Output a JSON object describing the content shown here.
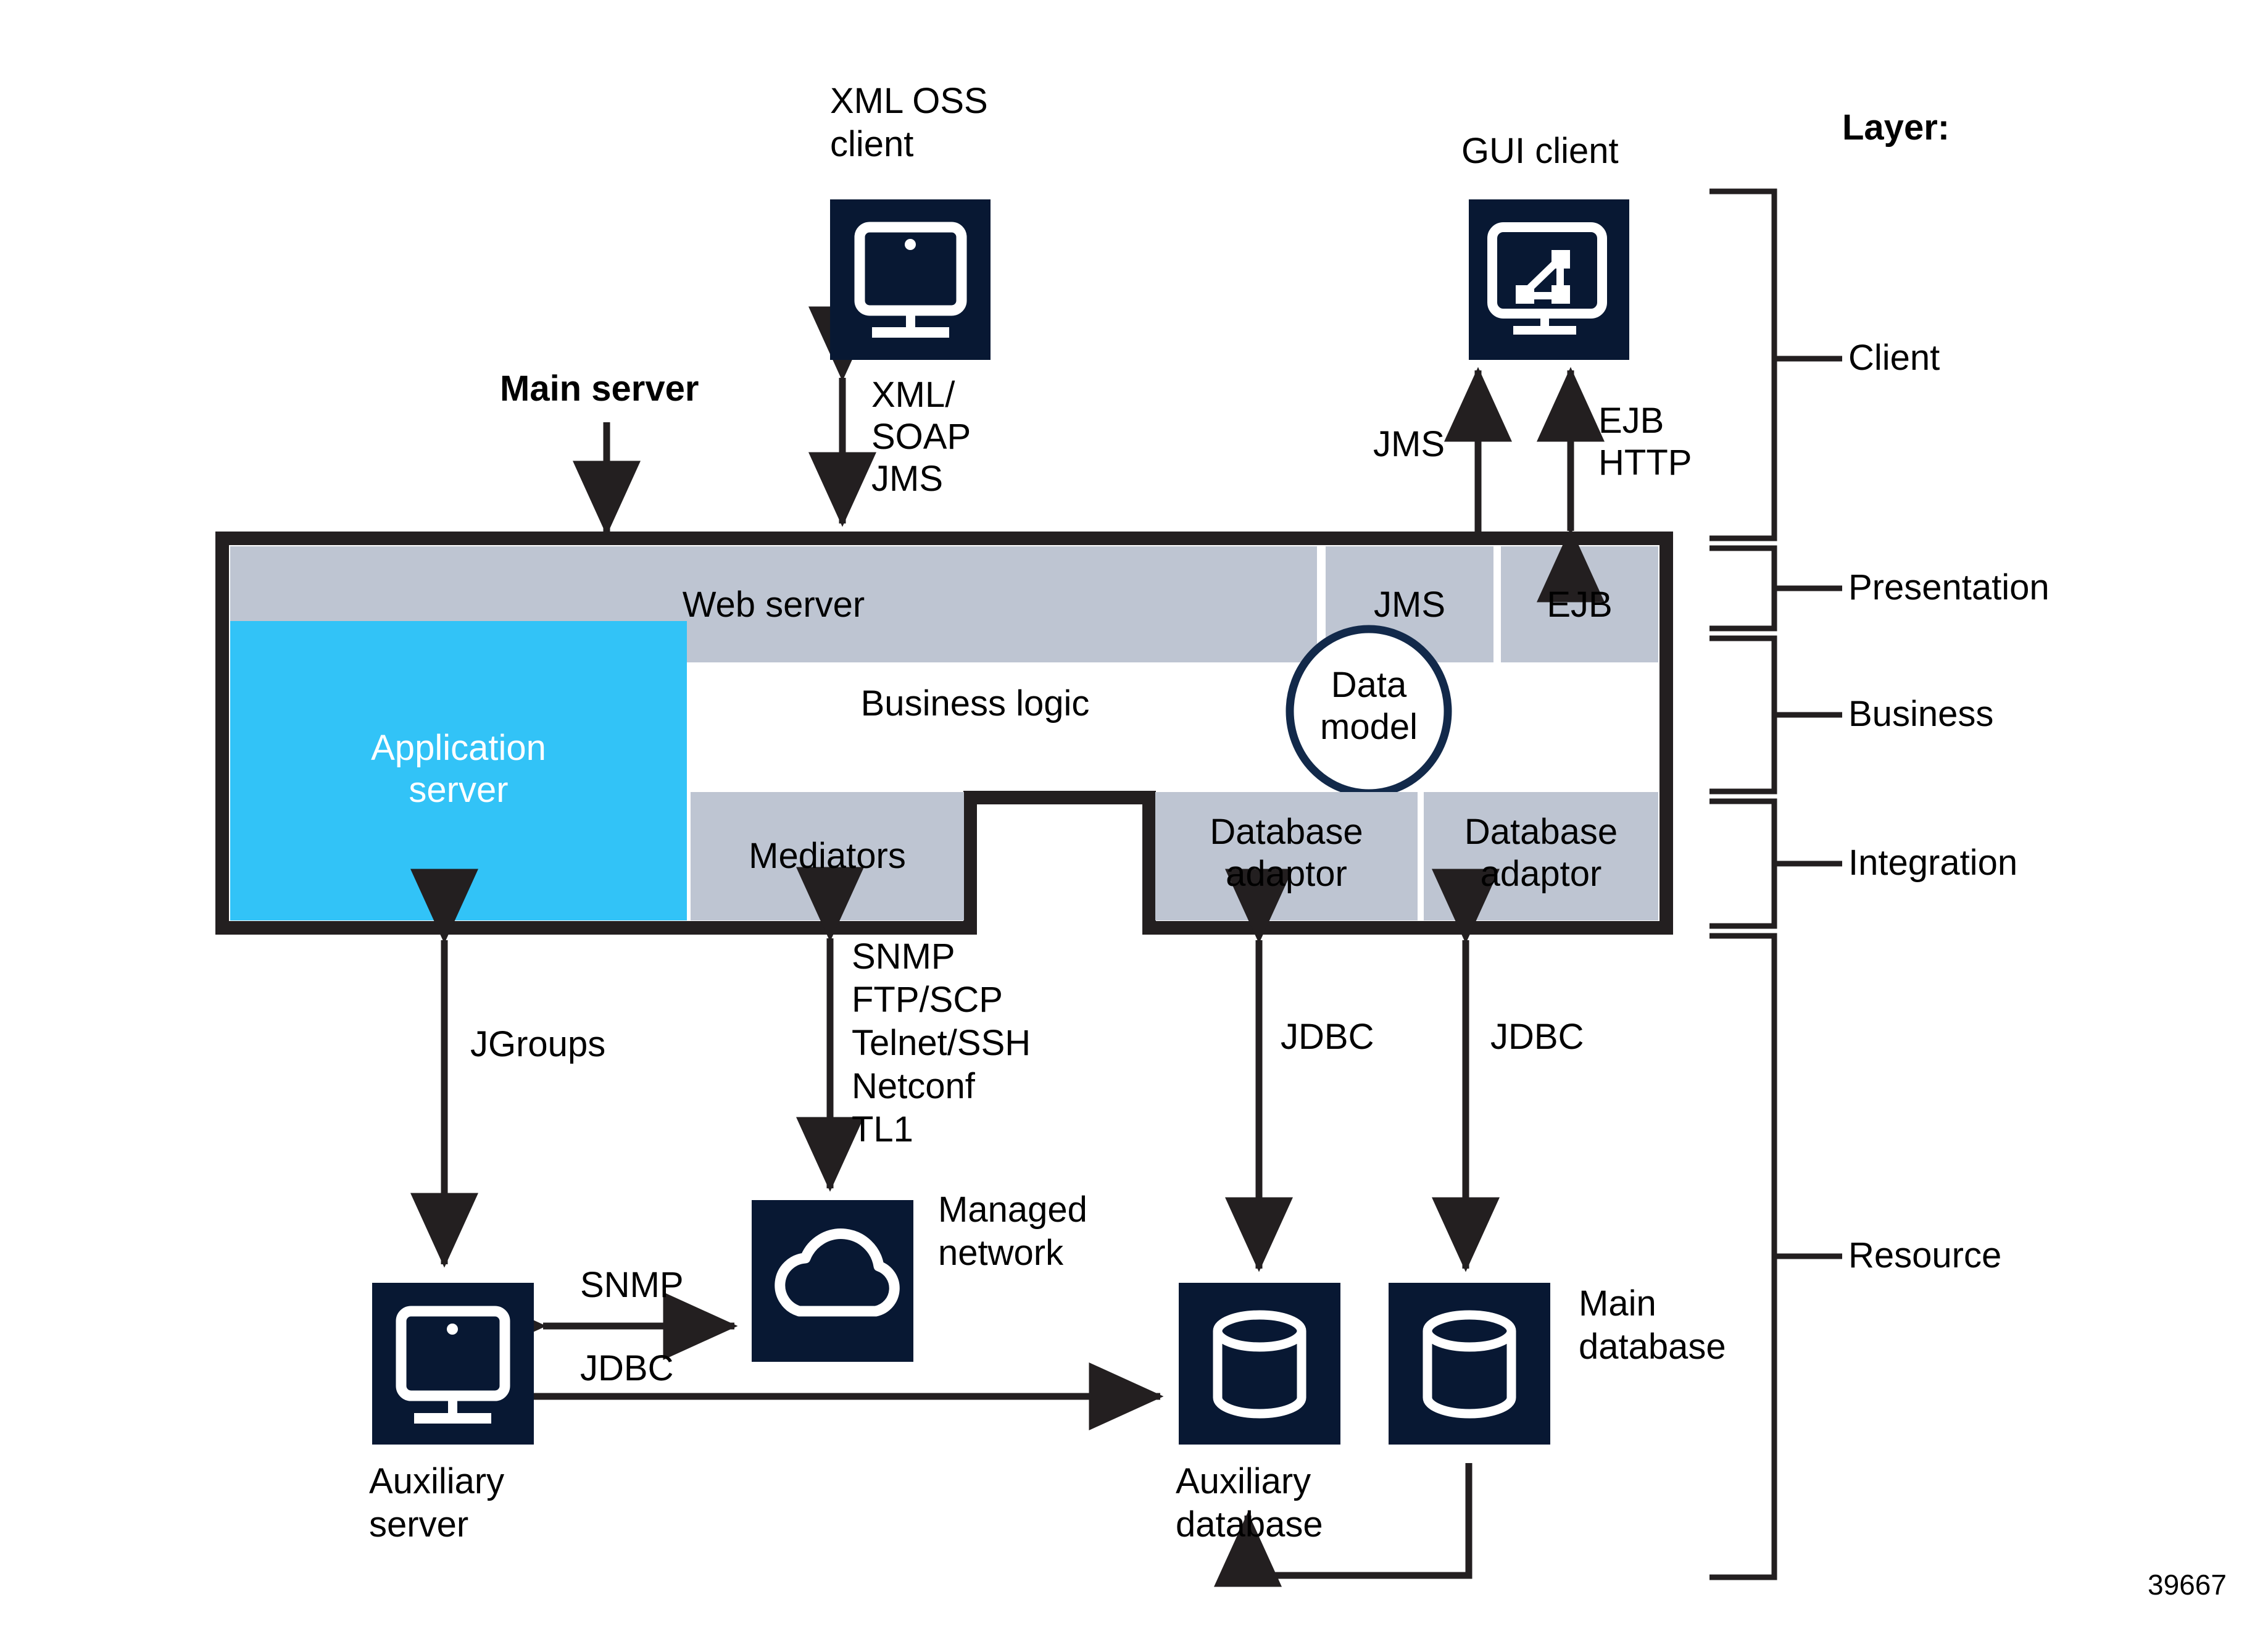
{
  "diagram": {
    "title": "Main server layered architecture",
    "figure_number": "39667",
    "colors": {
      "navy_icon": "#081833",
      "cyan_app_server": "#32c3f7",
      "gray_module": "#bec5d2",
      "outline_black": "#231f20",
      "text_black": "#000000"
    }
  },
  "layer_legend": {
    "heading": "Layer:",
    "layers": [
      {
        "name": "Client"
      },
      {
        "name": "Presentation"
      },
      {
        "name": "Business"
      },
      {
        "name": "Integration"
      },
      {
        "name": "Resource"
      }
    ]
  },
  "clients": {
    "xml_oss_client": {
      "label_line1": "XML OSS",
      "label_line2": "client",
      "icon": "monitor-icon"
    },
    "gui_client": {
      "label": "GUI client",
      "icon": "network-monitor-icon"
    }
  },
  "main_server": {
    "callout_label": "Main server",
    "presentation_row": [
      {
        "label": "Web server"
      },
      {
        "label": "JMS"
      },
      {
        "label": "EJB"
      }
    ],
    "business": {
      "app_server_line1": "Application",
      "app_server_line2": "server",
      "business_logic_label": "Business logic",
      "data_model_line1": "Data",
      "data_model_line2": "model"
    },
    "integration_row": [
      {
        "label": "Mediators"
      },
      {
        "label_line1": "Database",
        "label_line2": "adaptor"
      },
      {
        "label_line1": "Database",
        "label_line2": "adaptor"
      }
    ]
  },
  "resources": {
    "auxiliary_server": {
      "label_line1": "Auxiliary",
      "label_line2": "server",
      "icon": "monitor-icon"
    },
    "managed_network": {
      "label_line1": "Managed",
      "label_line2": "network",
      "icon": "cloud-icon"
    },
    "auxiliary_database": {
      "label_line1": "Auxiliary",
      "label_line2": "database",
      "icon": "database-cylinder-icon"
    },
    "main_database": {
      "label_line1": "Main",
      "label_line2": "database",
      "icon": "database-cylinder-icon"
    }
  },
  "connections": {
    "xml_oss": {
      "l1": "XML/",
      "l2": "SOAP",
      "l3": "JMS"
    },
    "gui_jms": "JMS",
    "gui_ejb": {
      "l1": "EJB",
      "l2": "HTTP"
    },
    "jgroups": "JGroups",
    "mediator_protocols": {
      "l1": "SNMP",
      "l2": "FTP/SCP",
      "l3": "Telnet/SSH",
      "l4": "Netconf",
      "l5": "TL1"
    },
    "jdbc_left": "JDBC",
    "jdbc_right": "JDBC",
    "aux_snmp": "SNMP",
    "aux_jdbc": "JDBC"
  }
}
